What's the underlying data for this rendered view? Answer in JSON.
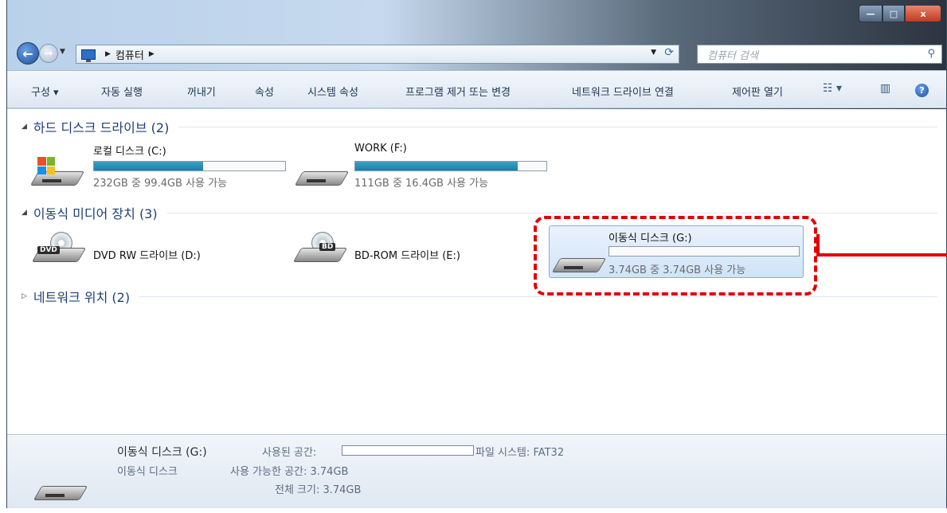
{
  "window": {
    "buttons": {
      "minimize": "—",
      "maximize": "□",
      "close": "x"
    }
  },
  "address": {
    "crumb": "컴퓨터",
    "search_placeholder": "컴퓨터 검색"
  },
  "toolbar": {
    "organize": "구성 ▾",
    "autoplay": "자동 실행",
    "eject": "꺼내기",
    "properties": "속성",
    "system_properties": "시스템 속성",
    "uninstall": "프로그램 제거 또는 변경",
    "map_network": "네트워크 드라이브 연결",
    "control_panel": "제어판 열기",
    "help": "?"
  },
  "groups": {
    "hard_disks": "하드 디스크 드라이브 (2)",
    "removable": "이동식 미디어 장치 (3)",
    "network": "네트워크 위치 (2)"
  },
  "drives": [
    {
      "name": "로컬 디스크 (C:)",
      "free": "232GB 중 99.4GB 사용 가능",
      "used_fraction": 0.57
    },
    {
      "name": "WORK (F:)",
      "free": "111GB 중 16.4GB 사용 가능",
      "used_fraction": 0.85
    },
    {
      "name": "DVD RW 드라이브 (D:)",
      "badge": "DVD"
    },
    {
      "name": "BD-ROM 드라이브 (E:)",
      "badge": "BD"
    },
    {
      "name": "이동식 디스크 (G:)",
      "free": "3.74GB 중 3.74GB 사용 가능",
      "used_fraction": 0.0
    }
  ],
  "details": {
    "name": "이동식 디스크 (G:)",
    "type": "이동식 디스크",
    "used_label": "사용된 공간:",
    "fs_label": "파일 시스템: FAT32",
    "free_label": "사용 가능한 공간: 3.74GB",
    "total_label": "전체 크기: 3.74GB"
  },
  "colors": {
    "highlight": "#e10000",
    "usage_bar": "#1f7ea6"
  }
}
